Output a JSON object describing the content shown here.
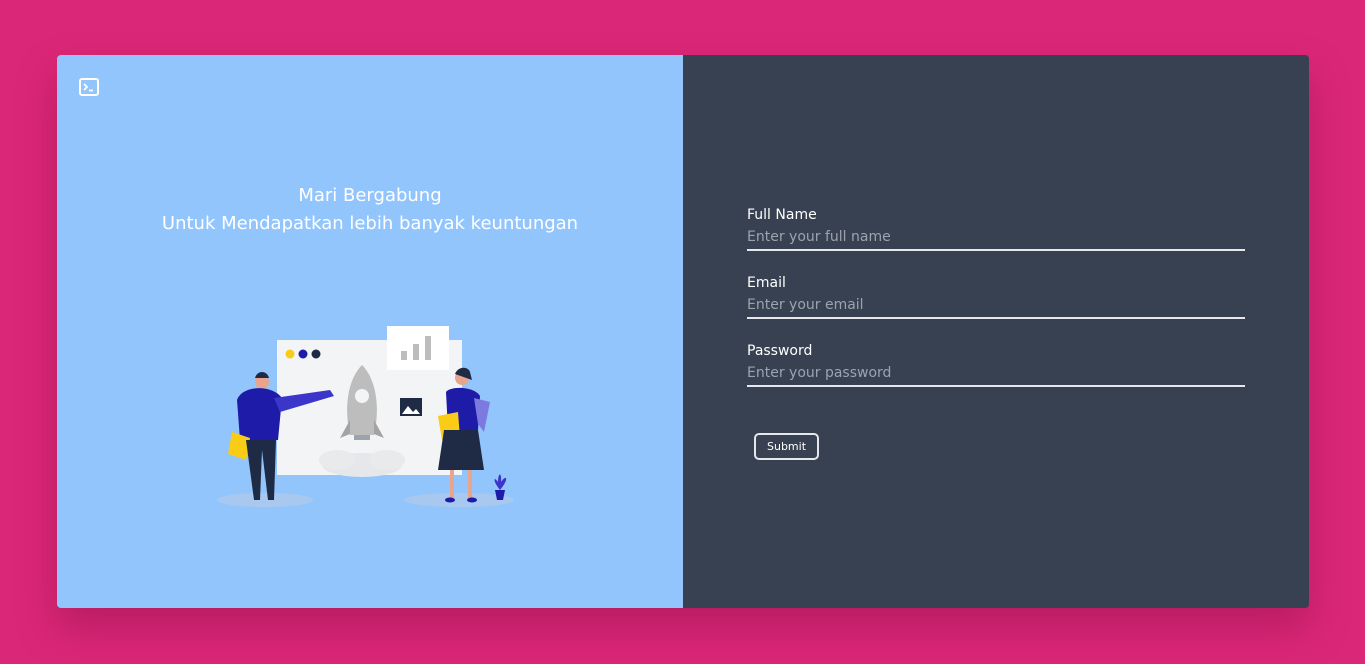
{
  "hero": {
    "line1": "Mari Bergabung",
    "line2": "Untuk Mendapatkan lebih banyak keuntungan",
    "logo_icon": "terminal-icon"
  },
  "form": {
    "fields": [
      {
        "label": "Full Name",
        "placeholder": "Enter your full name",
        "value": ""
      },
      {
        "label": "Email",
        "placeholder": "Enter your email",
        "value": ""
      },
      {
        "label": "Password",
        "placeholder": "Enter your password",
        "value": ""
      }
    ],
    "submit_label": "Submit"
  },
  "colors": {
    "background": "#DB2777",
    "left_panel": "#93C5FD",
    "right_panel": "#374151",
    "accent": "#1E1BA8"
  }
}
